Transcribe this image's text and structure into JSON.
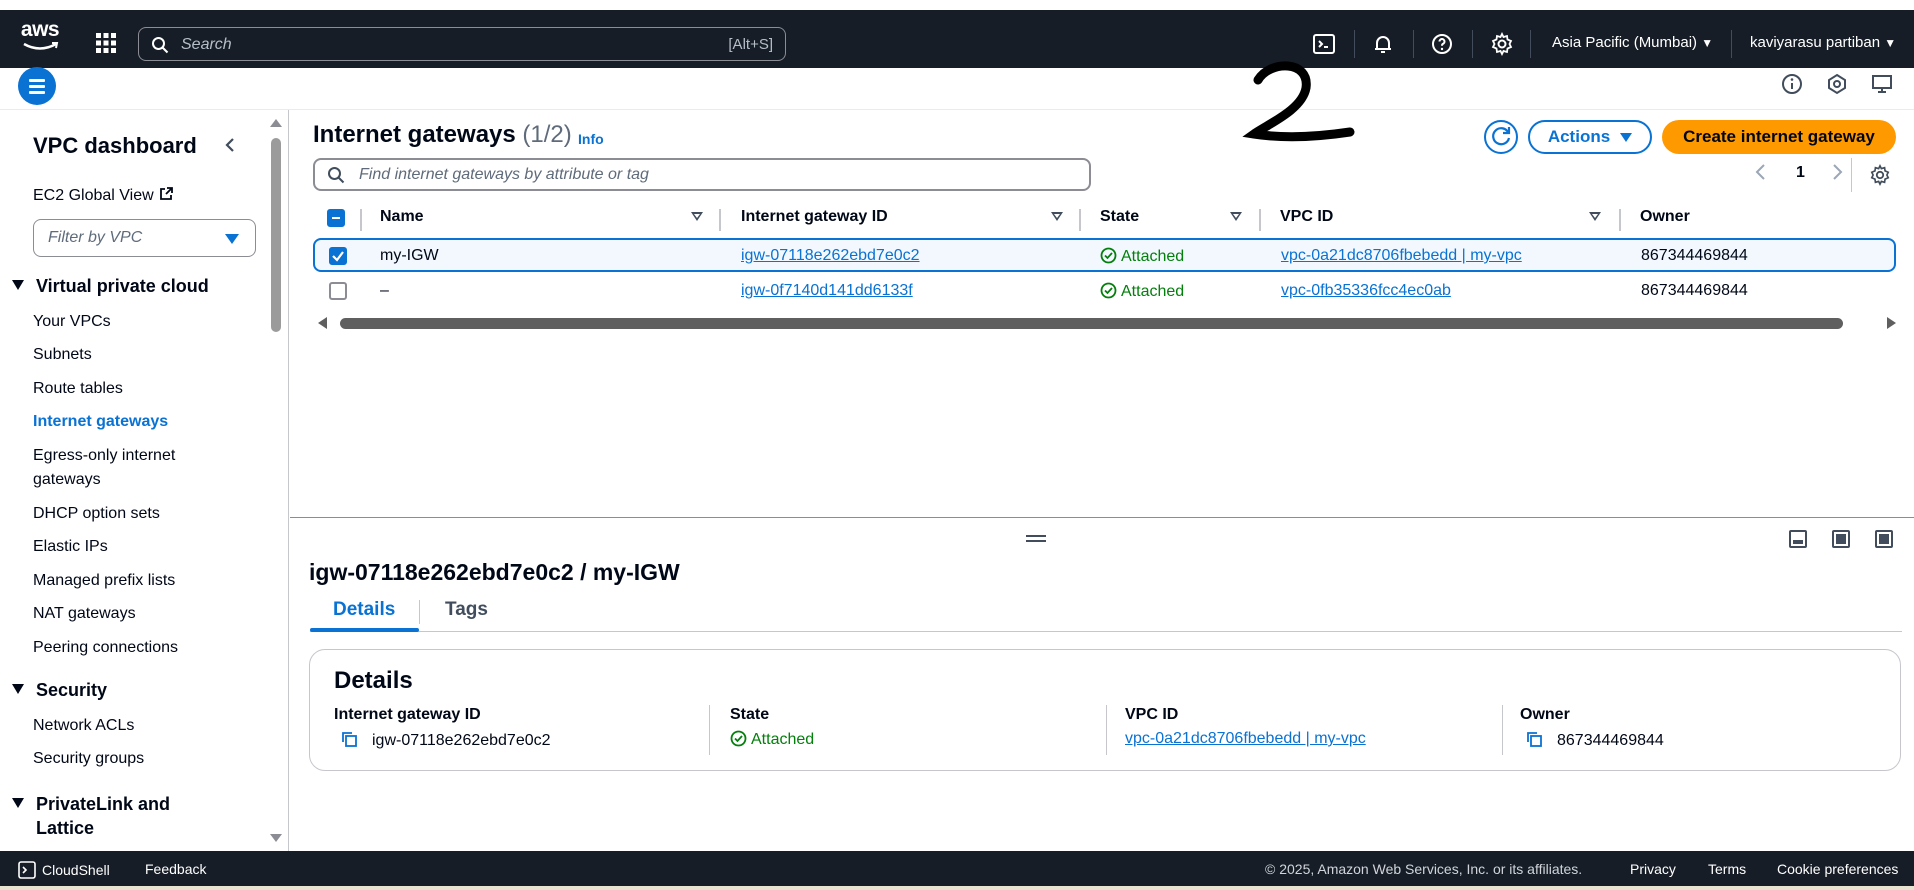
{
  "topbar": {
    "logo_text": "aws",
    "search_placeholder": "Search",
    "search_shortcut": "[Alt+S]",
    "region": "Asia Pacific (Mumbai)",
    "user": "kaviyarasu partiban",
    "icons": [
      "grid-icon",
      "search-icon",
      "cloudshell-icon",
      "bell-icon",
      "help-icon",
      "gear-icon"
    ]
  },
  "sidebar": {
    "title": "VPC dashboard",
    "global_view": "EC2 Global View",
    "filter_placeholder": "Filter by VPC",
    "sections": [
      {
        "title": "Virtual private cloud",
        "items": [
          "Your VPCs",
          "Subnets",
          "Route tables",
          "Internet gateways",
          "Egress-only internet gateways",
          "DHCP option sets",
          "Elastic IPs",
          "Managed prefix lists",
          "NAT gateways",
          "Peering connections"
        ]
      },
      {
        "title": "Security",
        "items": [
          "Network ACLs",
          "Security groups"
        ]
      },
      {
        "title": "PrivateLink and Lattice",
        "items": []
      }
    ],
    "active_item": "Internet gateways"
  },
  "main": {
    "title": "Internet gateways",
    "count": "(1/2)",
    "info": "Info",
    "actions_label": "Actions",
    "create_label": "Create internet gateway",
    "search_placeholder": "Find internet gateways by attribute or tag",
    "page": "1",
    "columns": [
      "Name",
      "Internet gateway ID",
      "State",
      "VPC ID",
      "Owner"
    ],
    "rows": [
      {
        "name": "my-IGW",
        "id": "igw-07118e262ebd7e0c2",
        "state": "Attached",
        "vpc": "vpc-0a21dc8706fbebedd | my-vpc",
        "owner": "867344469844",
        "selected": true
      },
      {
        "name": "–",
        "id": "igw-0f7140d141dd6133f",
        "state": "Attached",
        "vpc": "vpc-0fb35336fcc4ec0ab",
        "owner": "867344469844",
        "selected": false
      }
    ]
  },
  "annotation": "2",
  "detail": {
    "title": "igw-07118e262ebd7e0c2 / my-IGW",
    "tabs": [
      "Details",
      "Tags"
    ],
    "active_tab": "Details",
    "card_title": "Details",
    "fields": [
      {
        "label": "Internet gateway ID",
        "value": "igw-07118e262ebd7e0c2"
      },
      {
        "label": "State",
        "value": "Attached"
      },
      {
        "label": "VPC ID",
        "value": "vpc-0a21dc8706fbebedd | my-vpc"
      },
      {
        "label": "Owner",
        "value": "867344469844"
      }
    ]
  },
  "footer": {
    "cloudshell": "CloudShell",
    "feedback": "Feedback",
    "copyright": "© 2025, Amazon Web Services, Inc. or its affiliates.",
    "privacy": "Privacy",
    "terms": "Terms",
    "cookies": "Cookie preferences"
  },
  "colors": {
    "topbar_bg": "#161d26",
    "link": "#0972d3",
    "primary_button": "#ff9900",
    "success": "#037f0c"
  }
}
